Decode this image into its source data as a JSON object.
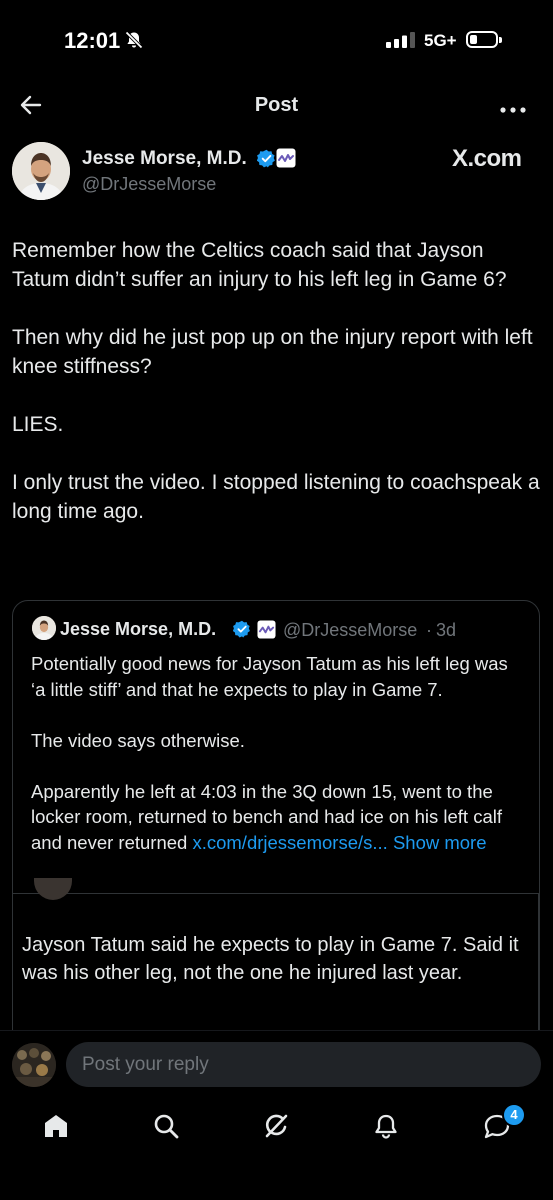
{
  "status_bar": {
    "time": "12:01",
    "network": "5G+"
  },
  "header": {
    "title": "Post"
  },
  "author": {
    "name": "Jesse Morse, M.D.",
    "handle": "@DrJesseMorse",
    "source_logo": "X.com"
  },
  "post": {
    "paragraphs": [
      "Remember how the Celtics coach said that Jayson Tatum didn’t suffer an injury to his left leg in Game 6?",
      "Then why did he just pop up on the injury report with left knee stiffness?",
      "LIES.",
      "I only trust the video. I stopped listening to coachspeak a long time ago."
    ]
  },
  "quote": {
    "name": "Jesse Morse, M.D.",
    "handle": "@DrJesseMorse",
    "separator": "·",
    "time": "3d",
    "paragraphs": [
      "Potentially good news for Jayson Tatum as his left leg was ‘a little stiff’ and that he expects to play in Game 7.",
      "The video says otherwise."
    ],
    "last_paragraph_text": "Apparently he left at 4:03 in the 3Q down 15, went to the locker room, returned to bench and had ice on his left calf and never returned ",
    "link_text": "x.com/drjessemorse/s...",
    "show_more": "Show more",
    "nested_text": "Jayson Tatum said he expects to play in Game 7. Said it was his other leg, not the one he injured last year."
  },
  "reply": {
    "placeholder": "Post your reply"
  },
  "tabbar": {
    "messages_badge": "4"
  },
  "icons": {
    "back": "back-arrow-icon",
    "more": "more-horizontal-icon",
    "verified": "verified-badge-icon",
    "affiliate": "affiliate-badge-icon",
    "home": "home-icon",
    "search": "search-icon",
    "grok": "grok-icon",
    "notifications": "bell-icon",
    "messages": "messages-icon"
  },
  "colors": {
    "background": "#000000",
    "text": "#e7e9ea",
    "secondary_text": "#71767b",
    "link": "#1d9bf0",
    "verified": "#1d9bf0",
    "border": "#2f3336"
  }
}
